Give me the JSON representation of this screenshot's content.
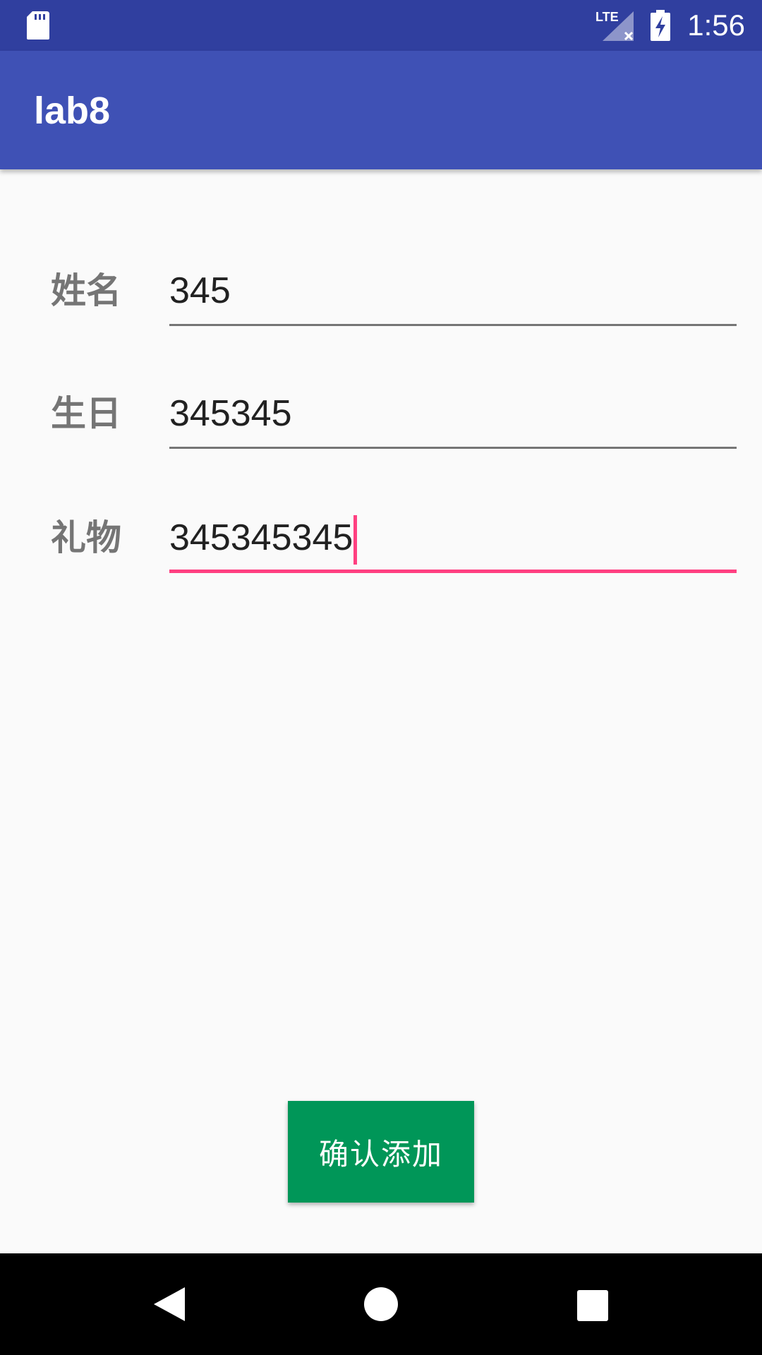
{
  "status_bar": {
    "time": "1:56",
    "network": "LTE",
    "icons": [
      "sd-card-icon",
      "lte-signal-icon",
      "battery-charging-icon"
    ]
  },
  "app_bar": {
    "title": "lab8"
  },
  "form": {
    "name": {
      "label": "姓名",
      "value": "345"
    },
    "birthday": {
      "label": "生日",
      "value": "345345"
    },
    "gift": {
      "label": "礼物",
      "value": "345345345"
    }
  },
  "confirm_button": {
    "label": "确认添加"
  },
  "colors": {
    "status_bar": "#303f9f",
    "app_bar": "#3f51b5",
    "accent": "#ff4081",
    "button": "#009658",
    "background": "#fafafa"
  },
  "nav_bar": {
    "icons": [
      "back-icon",
      "home-icon",
      "recents-icon"
    ]
  }
}
